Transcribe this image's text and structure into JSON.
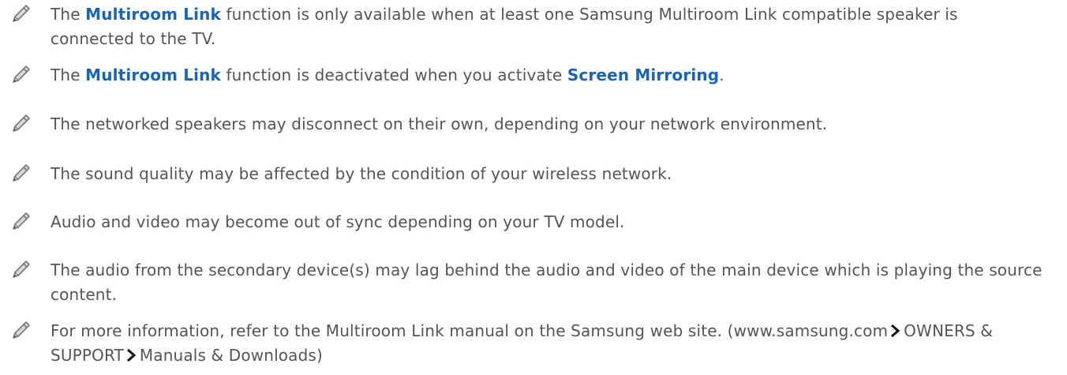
{
  "notes": [
    {
      "icon": "pencil-note-icon",
      "parts": [
        "The ",
        "Multiroom Link",
        " function is only available when at least one Samsung Multiroom Link compatible speaker is connected to the TV."
      ]
    },
    {
      "icon": "pencil-note-icon",
      "parts": [
        "The ",
        "Multiroom Link",
        " function is deactivated when you activate ",
        "Screen Mirroring",
        "."
      ]
    },
    {
      "icon": "pencil-note-icon",
      "text": "The networked speakers may disconnect on their own, depending on your network environment."
    },
    {
      "icon": "pencil-note-icon",
      "text": "The sound quality may be affected by the condition of your wireless network."
    },
    {
      "icon": "pencil-note-icon",
      "text": "Audio and video may become out of sync depending on your TV model."
    },
    {
      "icon": "pencil-note-icon",
      "text": "The audio from the secondary device(s) may lag behind the audio and video of the main device which is playing the source content."
    },
    {
      "icon": "pencil-note-icon",
      "parts": [
        "For more information, refer to the Multiroom Link manual on the Samsung web site. (www.samsung.com",
        "OWNERS & SUPPORT",
        "Manuals & Downloads)"
      ]
    }
  ],
  "colors": {
    "text": "#555555",
    "emphasis": "#1a64b8",
    "icon": "#8a8a8a"
  }
}
